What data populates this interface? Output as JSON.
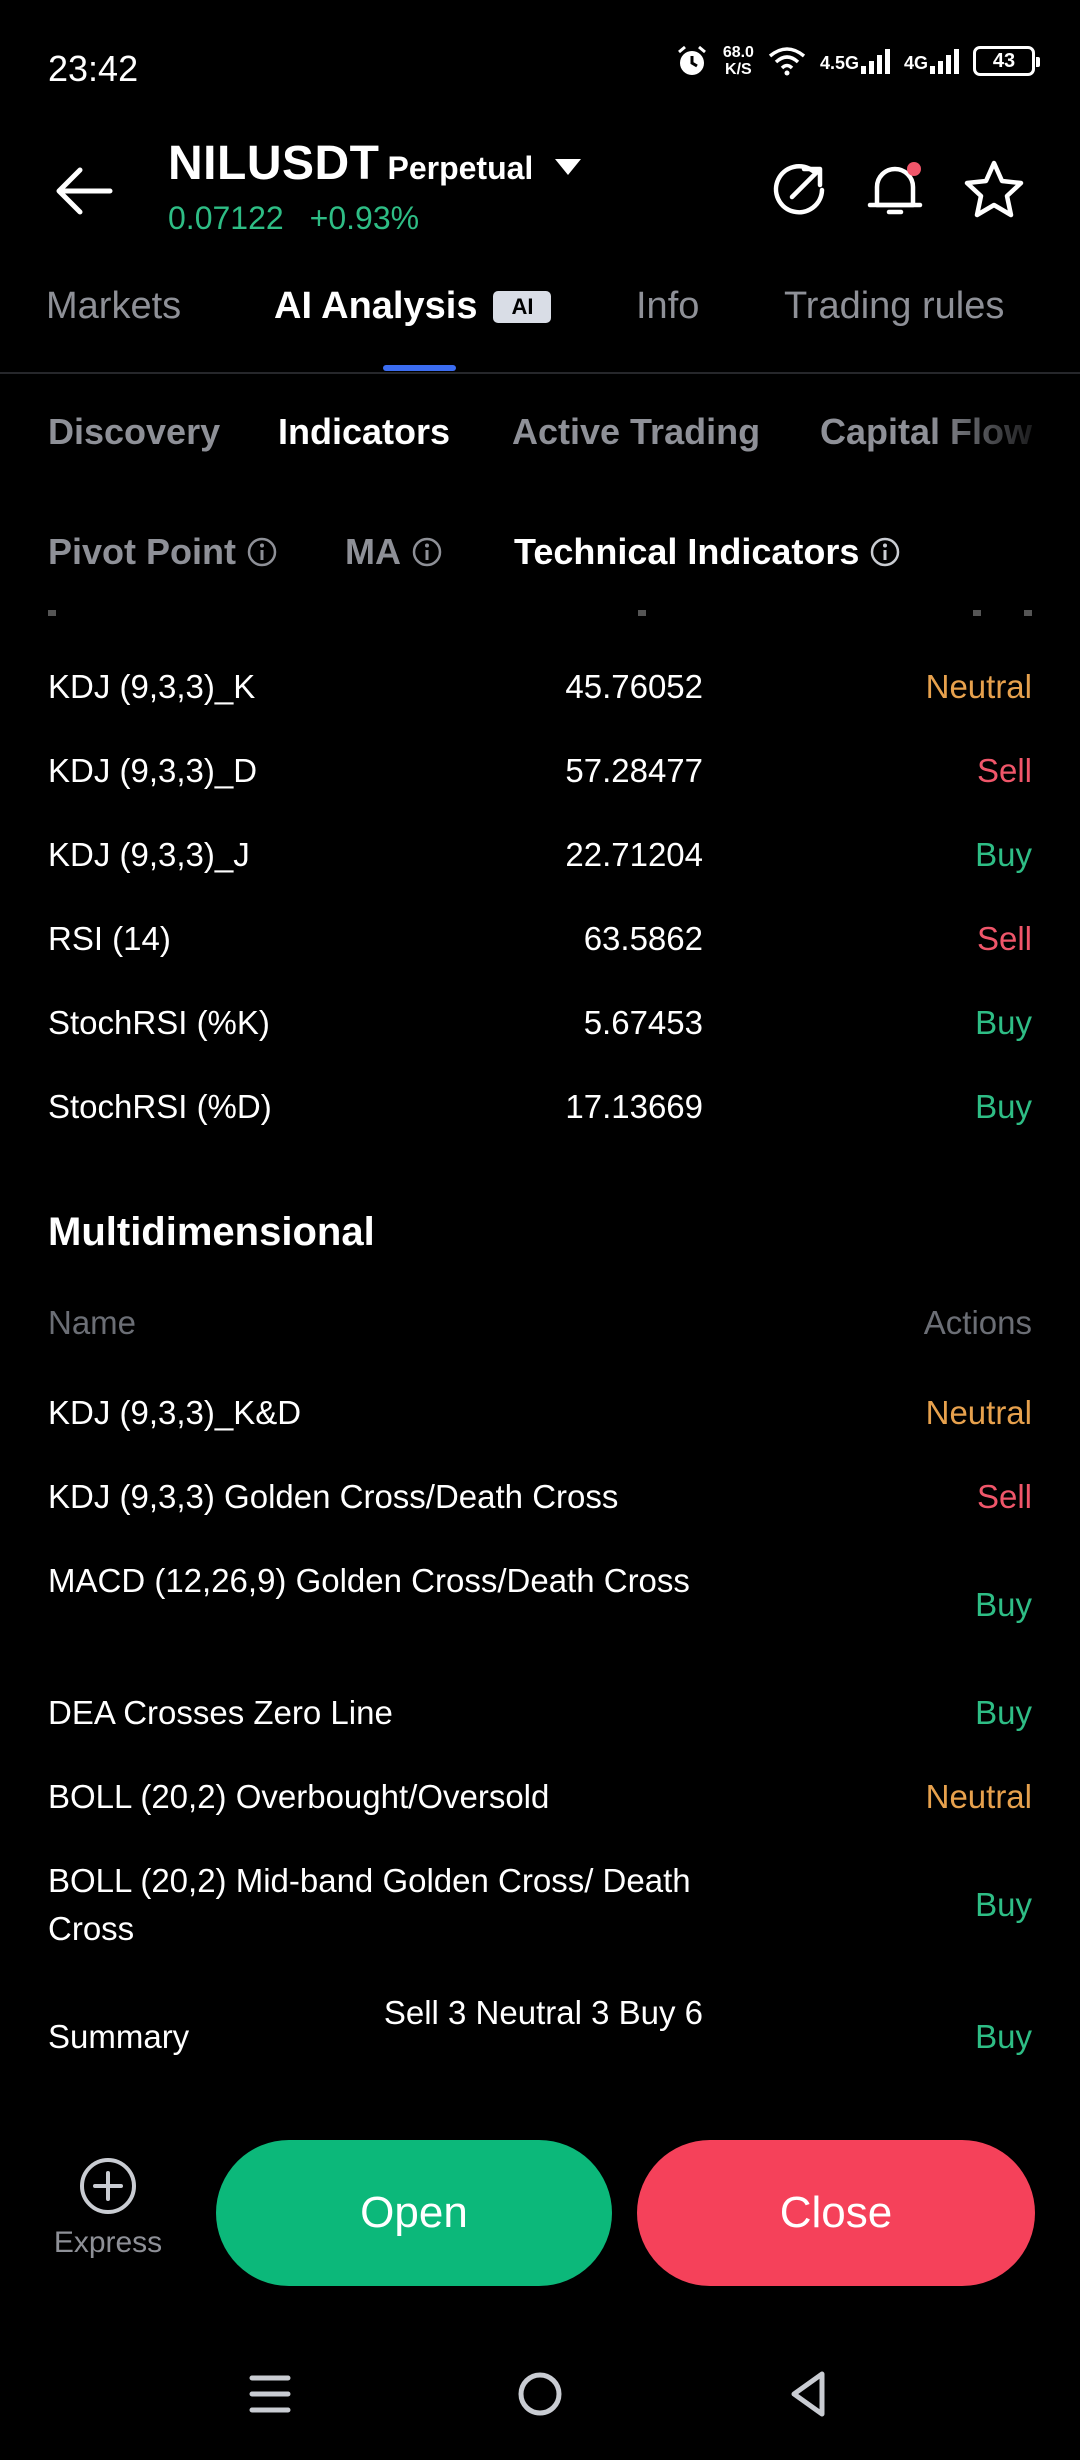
{
  "status_bar": {
    "time": "23:42",
    "speed_value": "68.0",
    "speed_unit": "K/S",
    "net1": "4.5G",
    "net2": "4G",
    "battery": "43"
  },
  "header": {
    "pair": "NILUSDT",
    "contract_type": "Perpetual",
    "price": "0.07122",
    "change": "+0.93%"
  },
  "main_tabs": {
    "markets": "Markets",
    "ai_analysis": "AI Analysis",
    "ai_badge": "AI",
    "info": "Info",
    "trading_rules": "Trading rules"
  },
  "sub_tabs": {
    "discovery": "Discovery",
    "indicators": "Indicators",
    "active_trading": "Active Trading",
    "capital_flow": "Capital Flow"
  },
  "indicator_tabs": {
    "pivot_point": "Pivot Point",
    "ma": "MA",
    "technical": "Technical Indicators"
  },
  "technical_rows": [
    {
      "name": "KDJ (9,3,3)_K",
      "value": "45.76052",
      "action": "Neutral"
    },
    {
      "name": "KDJ (9,3,3)_D",
      "value": "57.28477",
      "action": "Sell"
    },
    {
      "name": "KDJ (9,3,3)_J",
      "value": "22.71204",
      "action": "Buy"
    },
    {
      "name": "RSI (14)",
      "value": "63.5862",
      "action": "Sell"
    },
    {
      "name": "StochRSI (%K)",
      "value": "5.67453",
      "action": "Buy"
    },
    {
      "name": "StochRSI (%D)",
      "value": "17.13669",
      "action": "Buy"
    }
  ],
  "multidimensional": {
    "title": "Multidimensional",
    "col_name": "Name",
    "col_actions": "Actions",
    "rows": [
      {
        "name": "KDJ (9,3,3)_K&D",
        "action": "Neutral"
      },
      {
        "name": "KDJ (9,3,3) Golden Cross/Death Cross",
        "action": "Sell"
      },
      {
        "name": "MACD (12,26,9) Golden Cross/Death Cross",
        "action": "Buy"
      },
      {
        "name": "DEA Crosses Zero Line",
        "action": "Buy"
      },
      {
        "name": "BOLL (20,2) Overbought/Oversold",
        "action": "Neutral"
      },
      {
        "name": "BOLL (20,2) Mid-band Golden Cross/ Death Cross",
        "action": "Buy"
      }
    ],
    "summary": {
      "name": "Summary",
      "value": "Sell 3 Neutral 3 Buy 6",
      "action": "Buy"
    }
  },
  "bottom": {
    "express": "Express",
    "open": "Open",
    "close": "Close"
  },
  "colors": {
    "buy": "#2ebd85",
    "sell": "#f0566a",
    "neutral": "#e7a14d",
    "accent": "#3b6cf0"
  }
}
